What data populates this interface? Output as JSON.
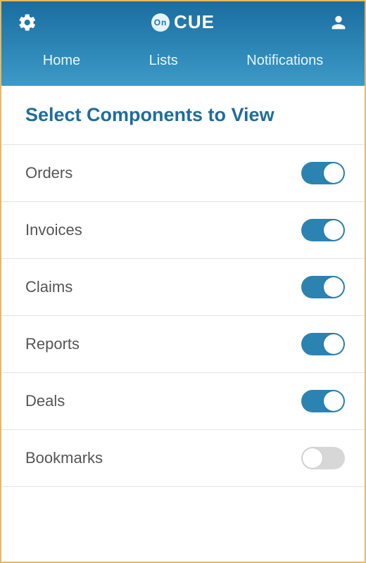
{
  "header": {
    "brand_badge_text": "On",
    "brand_text": "CUE",
    "tabs": [
      {
        "label": "Home"
      },
      {
        "label": "Lists"
      },
      {
        "label": "Notifications"
      }
    ]
  },
  "page": {
    "title": "Select Components to View"
  },
  "components": [
    {
      "label": "Orders",
      "enabled": true
    },
    {
      "label": "Invoices",
      "enabled": true
    },
    {
      "label": "Claims",
      "enabled": true
    },
    {
      "label": "Reports",
      "enabled": true
    },
    {
      "label": "Deals",
      "enabled": true
    },
    {
      "label": "Bookmarks",
      "enabled": false
    }
  ]
}
